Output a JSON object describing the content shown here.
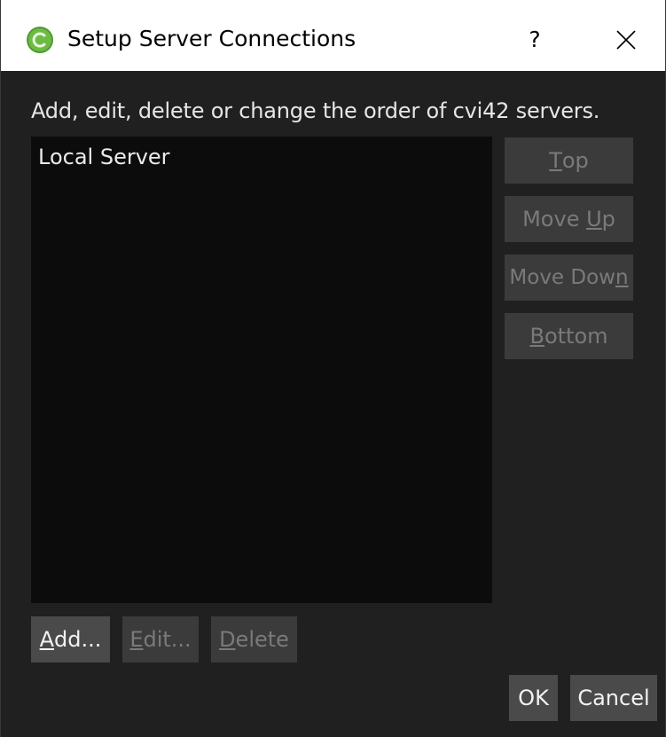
{
  "window": {
    "title": "Setup Server Connections",
    "help_label": "?",
    "app_icon": "green-circle-app-icon",
    "close_icon": "close-icon"
  },
  "description": "Add, edit, delete or change the order of cvi42 servers.",
  "servers": [
    {
      "name": "Local Server"
    }
  ],
  "order_buttons": {
    "top": {
      "pre": "",
      "key": "T",
      "post": "op"
    },
    "up": {
      "pre": "Move ",
      "key": "U",
      "post": "p"
    },
    "down": {
      "pre": "Move Dow",
      "key": "n",
      "post": ""
    },
    "bottom": {
      "pre": "",
      "key": "B",
      "post": "ottom"
    }
  },
  "edit_buttons": {
    "add": {
      "pre": "",
      "key": "A",
      "post": "dd..."
    },
    "edit": {
      "pre": "",
      "key": "E",
      "post": "dit..."
    },
    "delete": {
      "pre": "",
      "key": "D",
      "post": "elete"
    }
  },
  "dialog_buttons": {
    "ok": "OK",
    "cancel": "Cancel"
  },
  "colors": {
    "background": "#202020",
    "list_background": "#0c0c0c",
    "button_disabled": "#3b3b3b",
    "button_enabled": "#4a4a4a",
    "icon_green": "#5fae3c"
  }
}
